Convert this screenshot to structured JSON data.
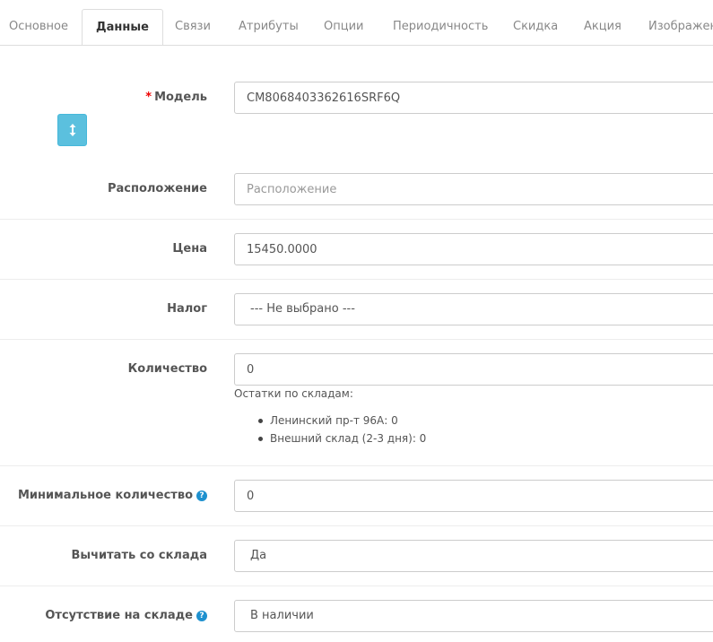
{
  "tabs": [
    {
      "label": "Основное"
    },
    {
      "label": "Данные"
    },
    {
      "label": "Связи"
    },
    {
      "label": "Атрибуты"
    },
    {
      "label": "Опции"
    },
    {
      "label": "Периодичность"
    },
    {
      "label": "Скидка"
    },
    {
      "label": "Акция"
    },
    {
      "label": "Изображения"
    }
  ],
  "active_tab": "Данные",
  "form": {
    "model": {
      "required_mark": "*",
      "label": "Модель",
      "value": "CM8068403362616SRF6Q"
    },
    "location": {
      "label": "Расположение",
      "placeholder": "Расположение"
    },
    "price": {
      "label": "Цена",
      "value": "15450.0000"
    },
    "tax": {
      "label": "Налог",
      "selected": "--- Не выбрано ---"
    },
    "quantity": {
      "label": "Количество",
      "value": "0",
      "stock_title": "Остатки по складам:",
      "stock": [
        "Ленинский пр-т 96А: 0",
        "Внешний склад (2-3 дня): 0"
      ]
    },
    "min_quantity": {
      "label": "Минимальное количество",
      "value": "0"
    },
    "subtract": {
      "label": "Вычитать со склада",
      "selected": "Да"
    },
    "out_of_stock": {
      "label": "Отсутствие на складе",
      "selected": "В наличии"
    }
  },
  "icons": {
    "side_button": "sort-vertical-icon",
    "help": "question-circle-icon"
  },
  "colors": {
    "side_button": "#5bc0de",
    "help_icon": "#1e91cf",
    "required": "#ee0000"
  }
}
